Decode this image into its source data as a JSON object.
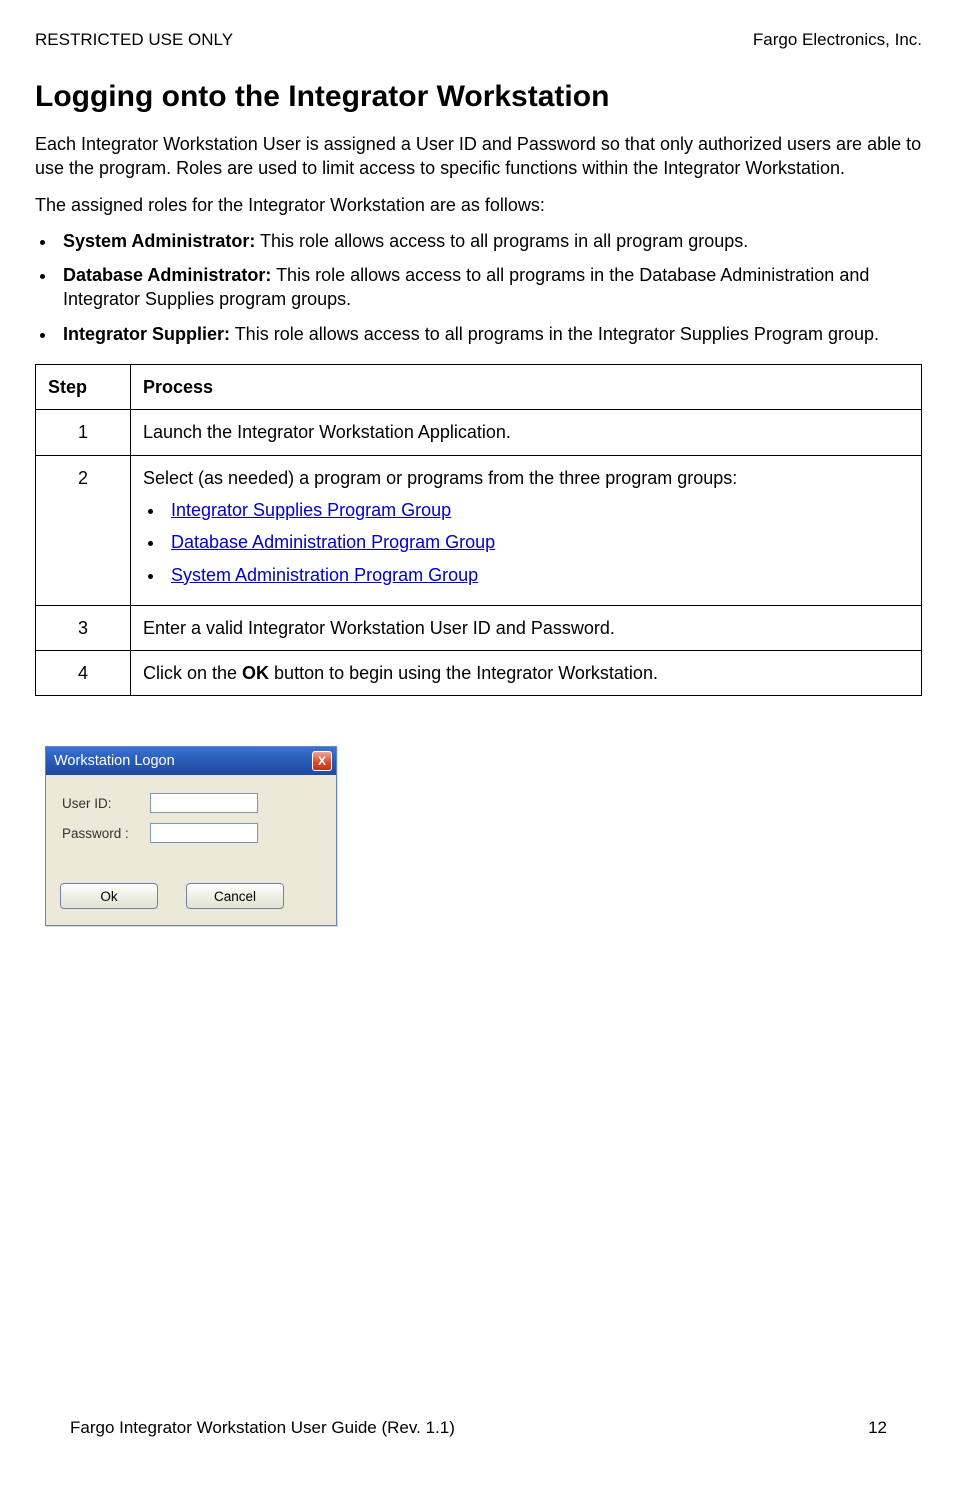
{
  "header": {
    "left": "RESTRICTED USE ONLY",
    "right": "Fargo Electronics, Inc."
  },
  "title": "Logging onto the Integrator Workstation",
  "intro_p1": "Each Integrator Workstation User is assigned a User ID and Password so that only authorized users are able to use the program.  Roles are used to limit access to specific functions within the Integrator Workstation.",
  "intro_p2": "The assigned roles for the Integrator Workstation are as follows:",
  "roles": [
    {
      "name": "System Administrator:",
      "desc": "  This role allows access to all programs in all program groups."
    },
    {
      "name": "Database Administrator:",
      "desc": "  This role allows access to all programs in the Database Administration and Integrator Supplies program groups."
    },
    {
      "name": "Integrator Supplier:",
      "desc": "  This role allows access to all programs in the Integrator Supplies Program group."
    }
  ],
  "table": {
    "col_step": "Step",
    "col_process": "Process",
    "rows": {
      "r1": {
        "num": "1",
        "text": "Launch the Integrator Workstation Application."
      },
      "r2": {
        "num": "2",
        "text": "Select (as needed) a program or programs from the three program groups:",
        "links": {
          "l1": "Integrator Supplies Program Group",
          "l2": "Database Administration Program Group",
          "l3": "System Administration Program Group"
        }
      },
      "r3": {
        "num": "3",
        "text": "Enter a valid Integrator Workstation User ID and Password."
      },
      "r4": {
        "num": "4",
        "pre": "Click on the ",
        "bold": "OK",
        "post": " button to begin using the Integrator Workstation."
      }
    }
  },
  "dialog": {
    "title": "Workstation Logon",
    "close": "X",
    "user_label": "User ID:",
    "pass_label": "Password :",
    "ok": "Ok",
    "cancel": "Cancel"
  },
  "footer": {
    "left": "Fargo Integrator Workstation User Guide (Rev. 1.1)",
    "right": "12"
  }
}
